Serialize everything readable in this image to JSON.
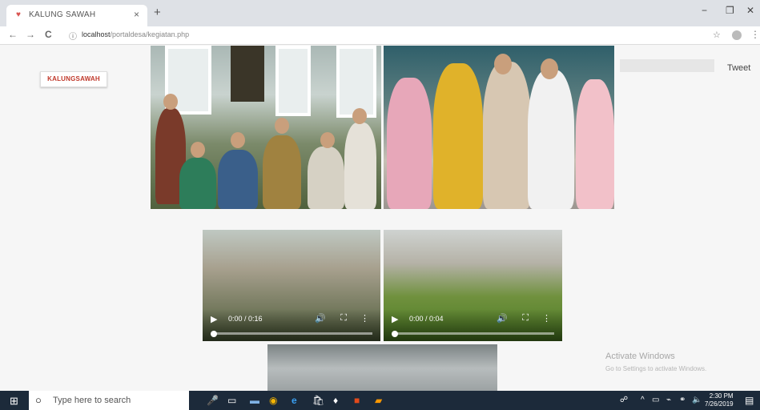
{
  "browser": {
    "tab_title": "KALUNG SAWAH",
    "tab_close": "×",
    "new_tab": "+",
    "url_host": "localhost",
    "url_path": "/portaldesa/kegiatan.php"
  },
  "page": {
    "logo_text": "KALUNGSAWAH",
    "tweet_label": "Tweet"
  },
  "videos": [
    {
      "time": "0:00 / 0:16"
    },
    {
      "time": "0:00 / 0:04"
    }
  ],
  "watermark": {
    "line1": "Activate Windows",
    "line2": "Go to Settings to activate Windows."
  },
  "taskbar": {
    "search_placeholder": "Type here to search",
    "time": "2:30 PM",
    "date": "7/26/2019"
  }
}
